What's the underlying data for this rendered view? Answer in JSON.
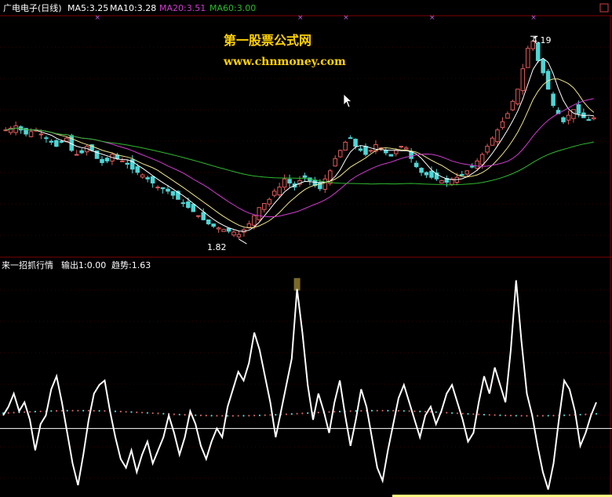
{
  "colors": {
    "background": "#000000",
    "up": "#e05a5a",
    "down": "#4fd6d6",
    "ma5": "#ffffff",
    "ma10": "#f0e68c",
    "ma20": "#d23cd2",
    "ma60": "#2fb92f",
    "panel_border": "#800000",
    "grid": "#3a0000",
    "watermark": "#ffd200",
    "marker": "#c060e0",
    "indicator": "#ffffff",
    "trend": "#d06060",
    "highlight": "#7a6a28",
    "hl_bar": "#ffff80"
  },
  "main_panel": {
    "name": "广电电子(日线)",
    "indicators": [
      {
        "label": "MA5:3.25",
        "color": "#ffffff"
      },
      {
        "label": "MA10:3.28",
        "color": "#ffffff"
      },
      {
        "label": "MA20:3.51",
        "color": "#d23cd2"
      },
      {
        "label": "MA60:3.00",
        "color": "#2fb92f"
      }
    ],
    "watermark_line1": "第一股票公式网",
    "watermark_line2": "www.chnmoney.com",
    "annotation_high": "4.19",
    "annotation_low": "1.82",
    "corner_icon": "window-restore-icon",
    "cursor_icon": "arrow-cursor-icon"
  },
  "sub_panel": {
    "title": "来一招抓行情",
    "output1": "输出1:0.00",
    "trend": "趋势:1.63"
  },
  "chart_data": [
    {
      "type": "candlestick",
      "title": "广电电子(日线)",
      "series": [
        {
          "name": "MA5",
          "last": 3.25
        },
        {
          "name": "MA10",
          "last": 3.28
        },
        {
          "name": "MA20",
          "last": 3.51
        },
        {
          "name": "MA60",
          "last": 3.0
        }
      ],
      "y_range": [
        1.6,
        4.5
      ],
      "annotations": [
        {
          "text": "4.19",
          "label": "high"
        },
        {
          "text": "1.82",
          "label": "low"
        }
      ],
      "close_path": [
        3.1,
        3.12,
        3.15,
        3.1,
        3.05,
        3.08,
        3.1,
        3.05,
        3.0,
        2.95,
        2.9,
        2.95,
        3.0,
        2.85,
        2.8,
        2.82,
        2.9,
        2.85,
        2.75,
        2.7,
        2.72,
        2.8,
        2.75,
        2.72,
        2.68,
        2.62,
        2.58,
        2.55,
        2.5,
        2.45,
        2.4,
        2.38,
        2.35,
        2.3,
        2.25,
        2.2,
        2.15,
        2.1,
        2.05,
        2.0,
        1.95,
        1.92,
        1.9,
        1.88,
        1.86,
        1.85,
        1.82,
        1.88,
        1.95,
        2.05,
        2.15,
        2.2,
        2.25,
        2.35,
        2.4,
        2.5,
        2.45,
        2.4,
        2.48,
        2.52,
        2.48,
        2.42,
        2.38,
        2.5,
        2.6,
        2.75,
        2.85,
        2.95,
        3.0,
        2.9,
        2.85,
        2.8,
        2.85,
        2.92,
        2.88,
        2.82,
        2.78,
        2.85,
        2.9,
        2.88,
        2.75,
        2.65,
        2.58,
        2.55,
        2.52,
        2.5,
        2.48,
        2.46,
        2.5,
        2.52,
        2.55,
        2.6,
        2.65,
        2.72,
        2.8,
        2.9,
        3.0,
        3.1,
        3.2,
        3.3,
        3.45,
        3.6,
        3.85,
        4.1,
        4.19,
        3.95,
        3.8,
        3.6,
        3.4,
        3.3,
        3.2,
        3.28,
        3.35,
        3.3,
        3.25,
        3.22,
        3.25
      ]
    },
    {
      "type": "line",
      "title": "来一招抓行情",
      "series": [
        {
          "name": "输出1",
          "last": 0.0
        },
        {
          "name": "趋势",
          "last": 1.63
        }
      ],
      "y_range": [
        -1.5,
        3.5
      ],
      "values": [
        0.3,
        0.5,
        0.8,
        0.4,
        0.6,
        0.2,
        -0.5,
        0.1,
        0.3,
        0.9,
        1.2,
        0.6,
        -0.1,
        -0.8,
        -1.3,
        -0.6,
        0.2,
        0.8,
        1.0,
        1.1,
        0.4,
        -0.2,
        -0.7,
        -0.9,
        -0.5,
        -1.0,
        -0.6,
        -0.3,
        -0.8,
        -0.5,
        -0.2,
        0.3,
        -0.1,
        -0.6,
        -0.2,
        0.4,
        0.1,
        -0.4,
        -0.7,
        -0.3,
        0.0,
        -0.2,
        0.5,
        0.9,
        1.3,
        1.1,
        1.5,
        2.2,
        1.8,
        1.2,
        0.6,
        -0.2,
        0.4,
        1.0,
        1.6,
        3.2,
        2.2,
        1.0,
        0.2,
        0.8,
        0.4,
        -0.1,
        0.6,
        1.1,
        0.3,
        -0.4,
        0.2,
        0.9,
        0.5,
        -0.2,
        -0.9,
        -1.2,
        -0.5,
        0.1,
        0.7,
        1.0,
        0.6,
        0.2,
        -0.2,
        0.3,
        0.5,
        0.1,
        0.4,
        0.8,
        1.0,
        0.6,
        0.2,
        -0.3,
        -0.1,
        0.6,
        1.2,
        0.8,
        1.4,
        1.0,
        0.6,
        1.8,
        3.4,
        2.0,
        0.8,
        0.3,
        -0.4,
        -1.0,
        -1.4,
        -0.8,
        0.2,
        1.1,
        0.9,
        0.4,
        -0.4,
        -0.1,
        0.3,
        0.6
      ]
    }
  ]
}
